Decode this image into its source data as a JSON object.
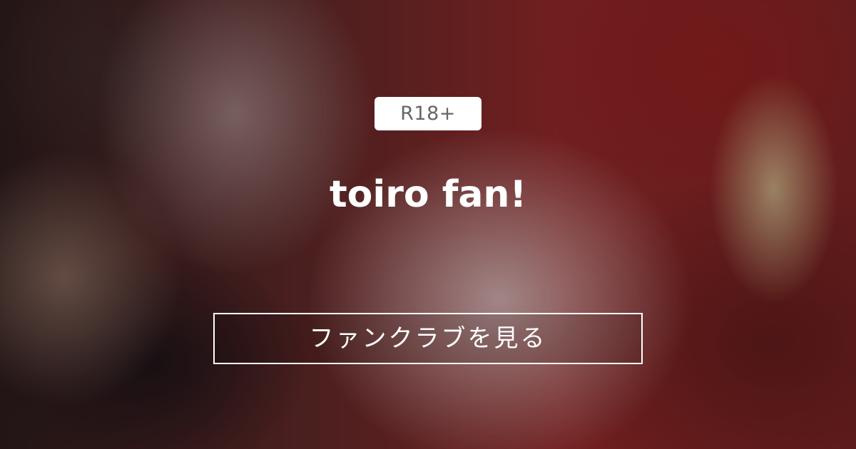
{
  "badge": {
    "text": "R18+"
  },
  "title": "toiro fan!",
  "cta": {
    "label": "ファンクラブを見る"
  }
}
